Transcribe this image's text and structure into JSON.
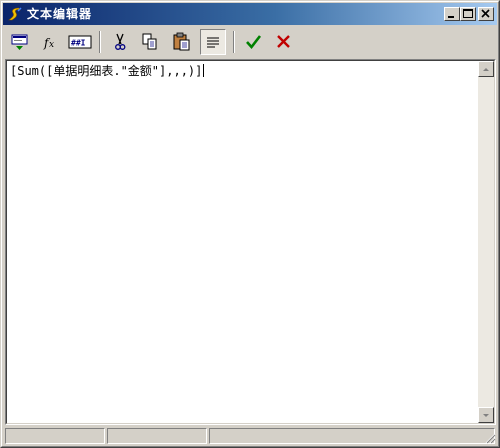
{
  "window": {
    "title": "文本编辑器",
    "controls": {
      "minimize_icon": "minimize-icon",
      "maximize_icon": "maximize-icon",
      "close_icon": "close-icon"
    }
  },
  "toolbar": {
    "tools": [
      {
        "icon": "insert-field-icon"
      },
      {
        "icon": "function-fx-icon",
        "label": "fx"
      },
      {
        "icon": "format-number-icon",
        "label": "##I"
      },
      {
        "icon": "cut-icon"
      },
      {
        "icon": "copy-icon"
      },
      {
        "icon": "paste-icon"
      },
      {
        "icon": "word-wrap-icon",
        "pressed": true
      },
      {
        "icon": "confirm-check-icon",
        "color": "#008000"
      },
      {
        "icon": "cancel-x-icon",
        "color": "#c00000"
      }
    ]
  },
  "editor": {
    "content": "[Sum([单据明细表.\"金额\"],,,)]"
  },
  "statusbar": {
    "panels": [
      "",
      "",
      ""
    ]
  },
  "colors": {
    "title_gradient_start": "#0a246a",
    "title_gradient_end": "#a6caf0",
    "face": "#d4d0c8"
  }
}
